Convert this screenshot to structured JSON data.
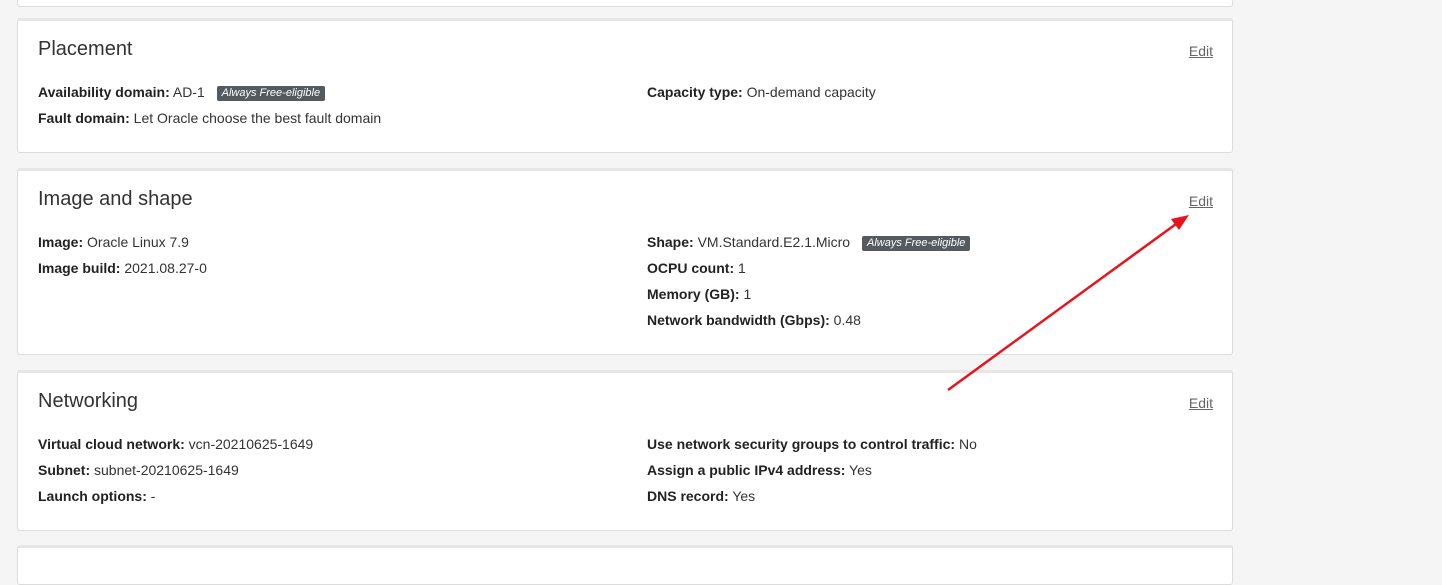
{
  "placement": {
    "title": "Placement",
    "edit_label": "Edit",
    "left": [
      {
        "label": "Availability domain:",
        "value": "AD-1",
        "badge": "Always Free-eligible"
      },
      {
        "label": "Fault domain:",
        "value": "Let Oracle choose the best fault domain"
      }
    ],
    "right": [
      {
        "label": "Capacity type:",
        "value": "On-demand capacity"
      }
    ]
  },
  "image_shape": {
    "title": "Image and shape",
    "edit_label": "Edit",
    "left": [
      {
        "label": "Image:",
        "value": "Oracle Linux 7.9"
      },
      {
        "label": "Image build:",
        "value": "2021.08.27-0"
      }
    ],
    "right": [
      {
        "label": "Shape:",
        "value": "VM.Standard.E2.1.Micro",
        "badge": "Always Free-eligible"
      },
      {
        "label": "OCPU count:",
        "value": "1"
      },
      {
        "label": "Memory (GB):",
        "value": "1"
      },
      {
        "label": "Network bandwidth (Gbps):",
        "value": "0.48"
      }
    ]
  },
  "networking": {
    "title": "Networking",
    "edit_label": "Edit",
    "left": [
      {
        "label": "Virtual cloud network:",
        "value": "vcn-20210625-1649"
      },
      {
        "label": "Subnet:",
        "value": "subnet-20210625-1649"
      },
      {
        "label": "Launch options:",
        "value": "-"
      }
    ],
    "right": [
      {
        "label": "Use network security groups to control traffic:",
        "value": "No"
      },
      {
        "label": "Assign a public IPv4 address:",
        "value": "Yes"
      },
      {
        "label": "DNS record:",
        "value": "Yes"
      }
    ]
  },
  "colors": {
    "annotation_arrow": "#e8141c",
    "badge_bg": "#555a5e"
  }
}
